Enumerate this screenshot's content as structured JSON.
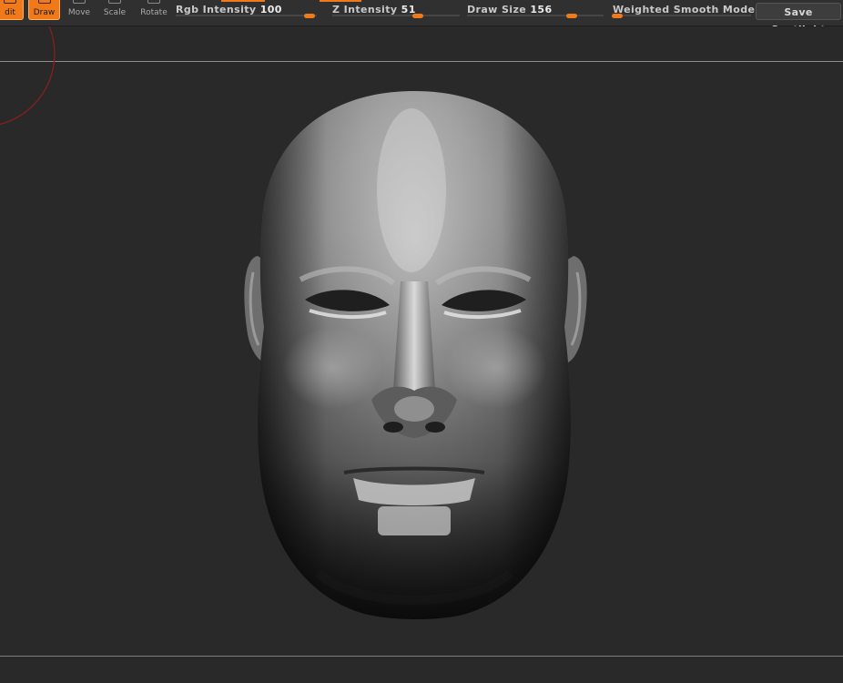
{
  "toolbar": {
    "tools": [
      {
        "label": "Edit",
        "display": "dit",
        "active": true
      },
      {
        "label": "Draw",
        "display": "Draw",
        "active": true
      },
      {
        "label": "Move",
        "display": "Move",
        "active": false
      },
      {
        "label": "Scale",
        "display": "Scale",
        "active": false
      },
      {
        "label": "Rotate",
        "display": "Rotate",
        "active": false
      }
    ],
    "rgb_intensity": {
      "label": "Rgb Intensity",
      "value": "100"
    },
    "z_intensity": {
      "label": "Z Intensity",
      "value": "51"
    },
    "draw_size": {
      "label": "Draw Size",
      "value": "156"
    },
    "weighted_smooth_mode": {
      "label": "Weighted Smooth Mode",
      "value": "0"
    },
    "save_spotlight_label": "Save Spotlight"
  },
  "viewport": {
    "subject": "sculpted-head-mesh",
    "brush_cursor_color": "#8a1e1e"
  },
  "colors": {
    "accent": "#f07a1a",
    "background": "#292929",
    "toolbar": "#303030"
  },
  "icons": [
    "edit-icon",
    "draw-icon",
    "move-icon",
    "scale-icon",
    "rotate-icon"
  ]
}
